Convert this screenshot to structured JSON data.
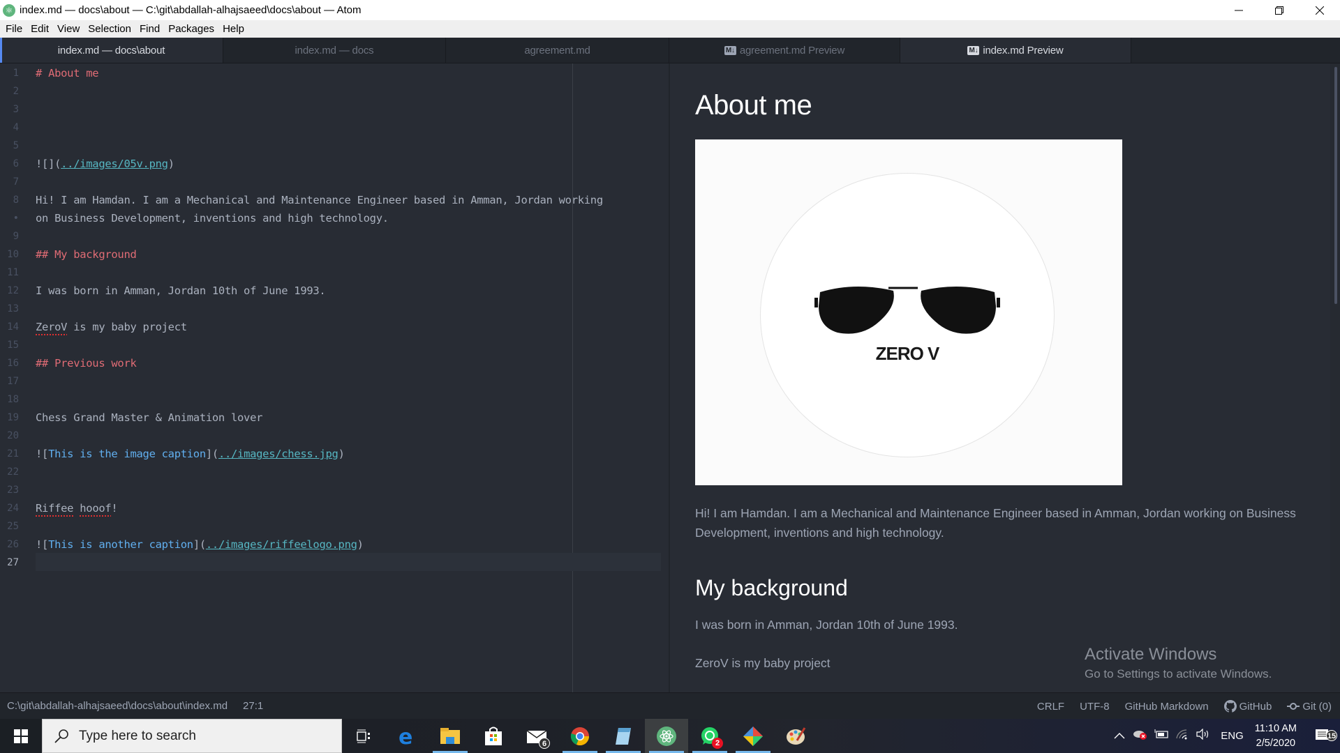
{
  "window": {
    "title": "index.md — docs\\about — C:\\git\\abdallah-alhajsaeed\\docs\\about — Atom",
    "controls": {
      "minimize": "—",
      "restore": "❐",
      "close": "✕"
    }
  },
  "menu": [
    "File",
    "Edit",
    "View",
    "Selection",
    "Find",
    "Packages",
    "Help"
  ],
  "tabs": [
    {
      "label": "index.md — docs\\about",
      "active": true,
      "icon": ""
    },
    {
      "label": "index.md — docs",
      "active": false,
      "icon": ""
    },
    {
      "label": "agreement.md",
      "active": false,
      "icon": ""
    },
    {
      "label": "agreement.md Preview",
      "active": false,
      "icon": "M↓"
    },
    {
      "label": "index.md Preview",
      "active": true,
      "icon": "M↓"
    }
  ],
  "editor": {
    "line_numbers": [
      "1",
      "2",
      "3",
      "4",
      "5",
      "6",
      "7",
      "8",
      "•",
      "9",
      "10",
      "11",
      "12",
      "13",
      "14",
      "15",
      "16",
      "17",
      "18",
      "19",
      "20",
      "21",
      "22",
      "23",
      "24",
      "25",
      "26",
      "27"
    ],
    "lines": {
      "l1": "# About me",
      "l6_a": "![](",
      "l6_link": "../images/05v.png",
      "l6_b": ")",
      "l8": "Hi! I am Hamdan. I am a Mechanical and Maintenance Engineer based in Amman, Jordan working",
      "l8_wrap": "on Business Development, inventions and high technology.",
      "l10": "## My background",
      "l12": "I was born in Amman, Jordan 10th of June 1993.",
      "l14_word": "ZeroV",
      "l14_rest": " is my baby project",
      "l16": "## Previous work",
      "l19": "Chess Grand Master & Animation lover",
      "l21_a": "![",
      "l21_cap": "This is the image caption",
      "l21_b": "](",
      "l21_link": "../images/chess.jpg",
      "l21_c": ")",
      "l24_w1": "Riffee",
      "l24_w2": "hooof",
      "l24_end": "!",
      "l26_a": "![",
      "l26_cap": "This is another caption",
      "l26_b": "](",
      "l26_link": "../images/riffeelogo.png",
      "l26_c": ")"
    }
  },
  "preview": {
    "h1": "About me",
    "image_text": "ZERO V",
    "p1": "Hi! I am Hamdan. I am a Mechanical and Maintenance Engineer based in Amman, Jordan working on Business Development, inventions and high technology.",
    "h2_background": "My background",
    "p2": "I was born in Amman, Jordan 10th of June 1993.",
    "p3": "ZeroV is my baby project"
  },
  "watermark": {
    "title": "Activate Windows",
    "subtitle": "Go to Settings to activate Windows."
  },
  "statusbar": {
    "path": "C:\\git\\abdallah-alhajsaeed\\docs\\about\\index.md",
    "cursor": "27:1",
    "line_ending": "CRLF",
    "encoding": "UTF-8",
    "grammar": "GitHub Markdown",
    "github": "GitHub",
    "git": "Git (0)"
  },
  "taskbar": {
    "search_placeholder": "Type here to search",
    "apps": [
      {
        "name": "task-view",
        "badge": ""
      },
      {
        "name": "edge",
        "badge": ""
      },
      {
        "name": "file-explorer",
        "badge": ""
      },
      {
        "name": "store",
        "badge": ""
      },
      {
        "name": "mail",
        "badge": "6"
      },
      {
        "name": "chrome",
        "badge": ""
      },
      {
        "name": "notepad",
        "badge": ""
      },
      {
        "name": "atom",
        "badge": ""
      },
      {
        "name": "whatsapp",
        "badge": "2"
      },
      {
        "name": "git-kraken",
        "badge": ""
      },
      {
        "name": "paint",
        "badge": ""
      }
    ],
    "language": "ENG",
    "time": "11:10 AM",
    "date": "2/5/2020",
    "notifications": "15"
  }
}
